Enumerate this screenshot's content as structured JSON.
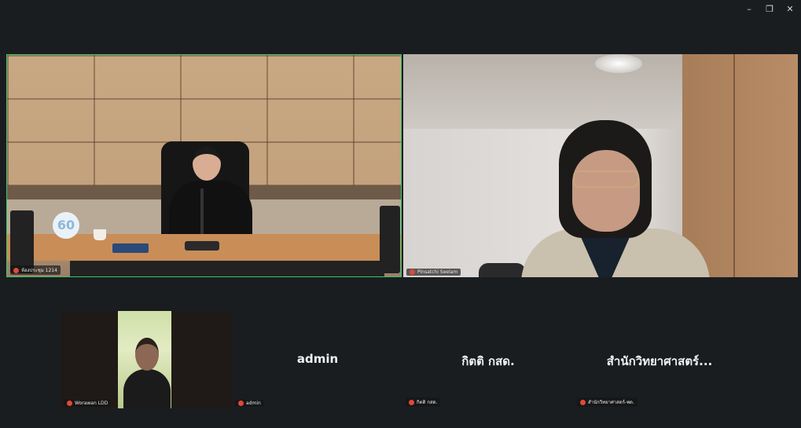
{
  "window_controls": {
    "minimize": "–",
    "restore": "❐",
    "close": "✕"
  },
  "tiles": {
    "meeting": {
      "name": "ห้องประชุม 1214",
      "badge": "60"
    },
    "p2": {
      "name": "Pinsatchi Seelam"
    },
    "worawan": {
      "name": "Worawan LDD"
    },
    "admin": {
      "display": "admin",
      "name": "admin"
    },
    "kitti": {
      "display": "กิตติ กสด.",
      "name": "กิตติ กสด."
    },
    "office": {
      "display": "สำนักวิทยาศาสตร์...",
      "name": "สำนักวิทยาศาสตร์-พด."
    }
  },
  "colors": {
    "active_speaker_border": "#38c96b",
    "muted_icon": "#e0483c",
    "background": "#1a1d20"
  }
}
